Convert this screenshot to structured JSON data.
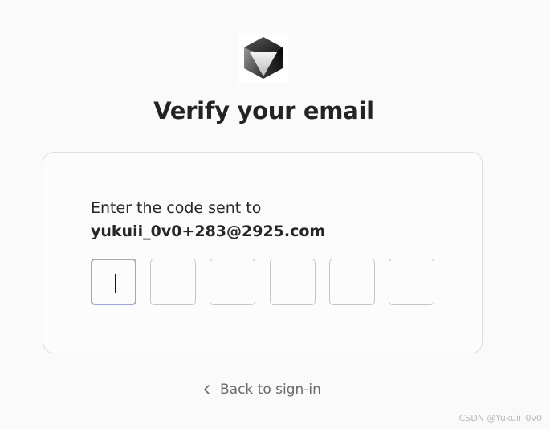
{
  "header": {
    "logo_icon": "cube-logo-icon",
    "title": "Verify your email"
  },
  "card": {
    "prompt": "Enter the code sent to",
    "email": "yukuii_0v0+283@2925.com",
    "code_digits": [
      "",
      "",
      "",
      "",
      "",
      ""
    ],
    "active_index": 0,
    "accent_color": "#9ea3e3"
  },
  "footer": {
    "back_icon": "chevron-left-icon",
    "back_label": "Back to sign-in"
  },
  "watermark": "CSDN @Yukuii_0v0"
}
